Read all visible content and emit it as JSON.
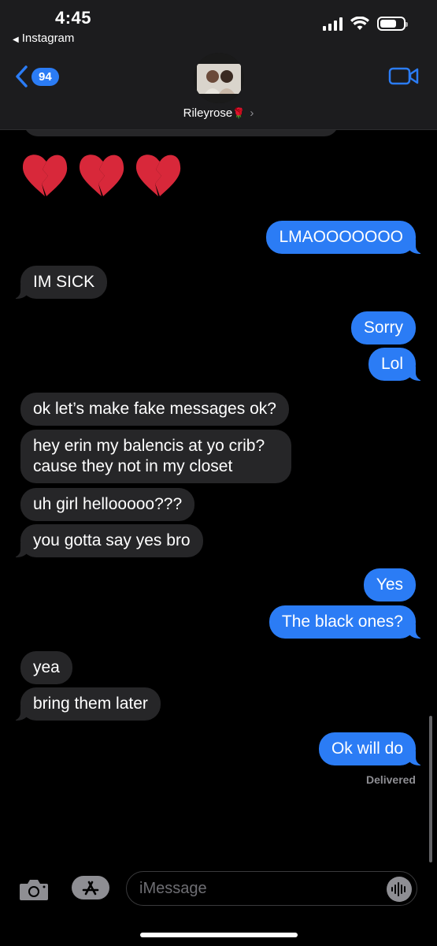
{
  "status_bar": {
    "time": "4:45",
    "back_app": "Instagram"
  },
  "header": {
    "unread_count": "94",
    "contact_name": "Rileyrose",
    "contact_emoji": "🌹"
  },
  "colors": {
    "sent_bubble": "#2b7cf5",
    "received_bubble": "#262628",
    "background": "#000000"
  },
  "icons": [
    "back-chevron-icon",
    "video-call-icon",
    "camera-icon",
    "app-store-icon",
    "audio-waveform-icon",
    "broken-heart-icon",
    "signal-icon",
    "wifi-icon",
    "battery-icon"
  ],
  "messages": [
    {
      "dir": "in",
      "emoji": "broken-heart x3"
    },
    {
      "dir": "out",
      "text": "LMAOOOOOOO"
    },
    {
      "dir": "in",
      "text": "IM SICK"
    },
    {
      "dir": "out",
      "text": "Sorry"
    },
    {
      "dir": "out",
      "text": "Lol"
    },
    {
      "dir": "in",
      "text": "ok let’s make fake messages ok?"
    },
    {
      "dir": "in",
      "text_line1": "hey erin my balencis at yo crib?",
      "text_line2": "cause they not in my closet"
    },
    {
      "dir": "in",
      "text": "uh girl hellooooo???"
    },
    {
      "dir": "in",
      "text": "you gotta say yes bro"
    },
    {
      "dir": "out",
      "text": "Yes"
    },
    {
      "dir": "out",
      "text": "The black ones?"
    },
    {
      "dir": "in",
      "text": "yea"
    },
    {
      "dir": "in",
      "text": "bring them later"
    },
    {
      "dir": "out",
      "text": "Ok will do"
    }
  ],
  "delivery_status": "Delivered",
  "composer": {
    "placeholder": "iMessage"
  }
}
